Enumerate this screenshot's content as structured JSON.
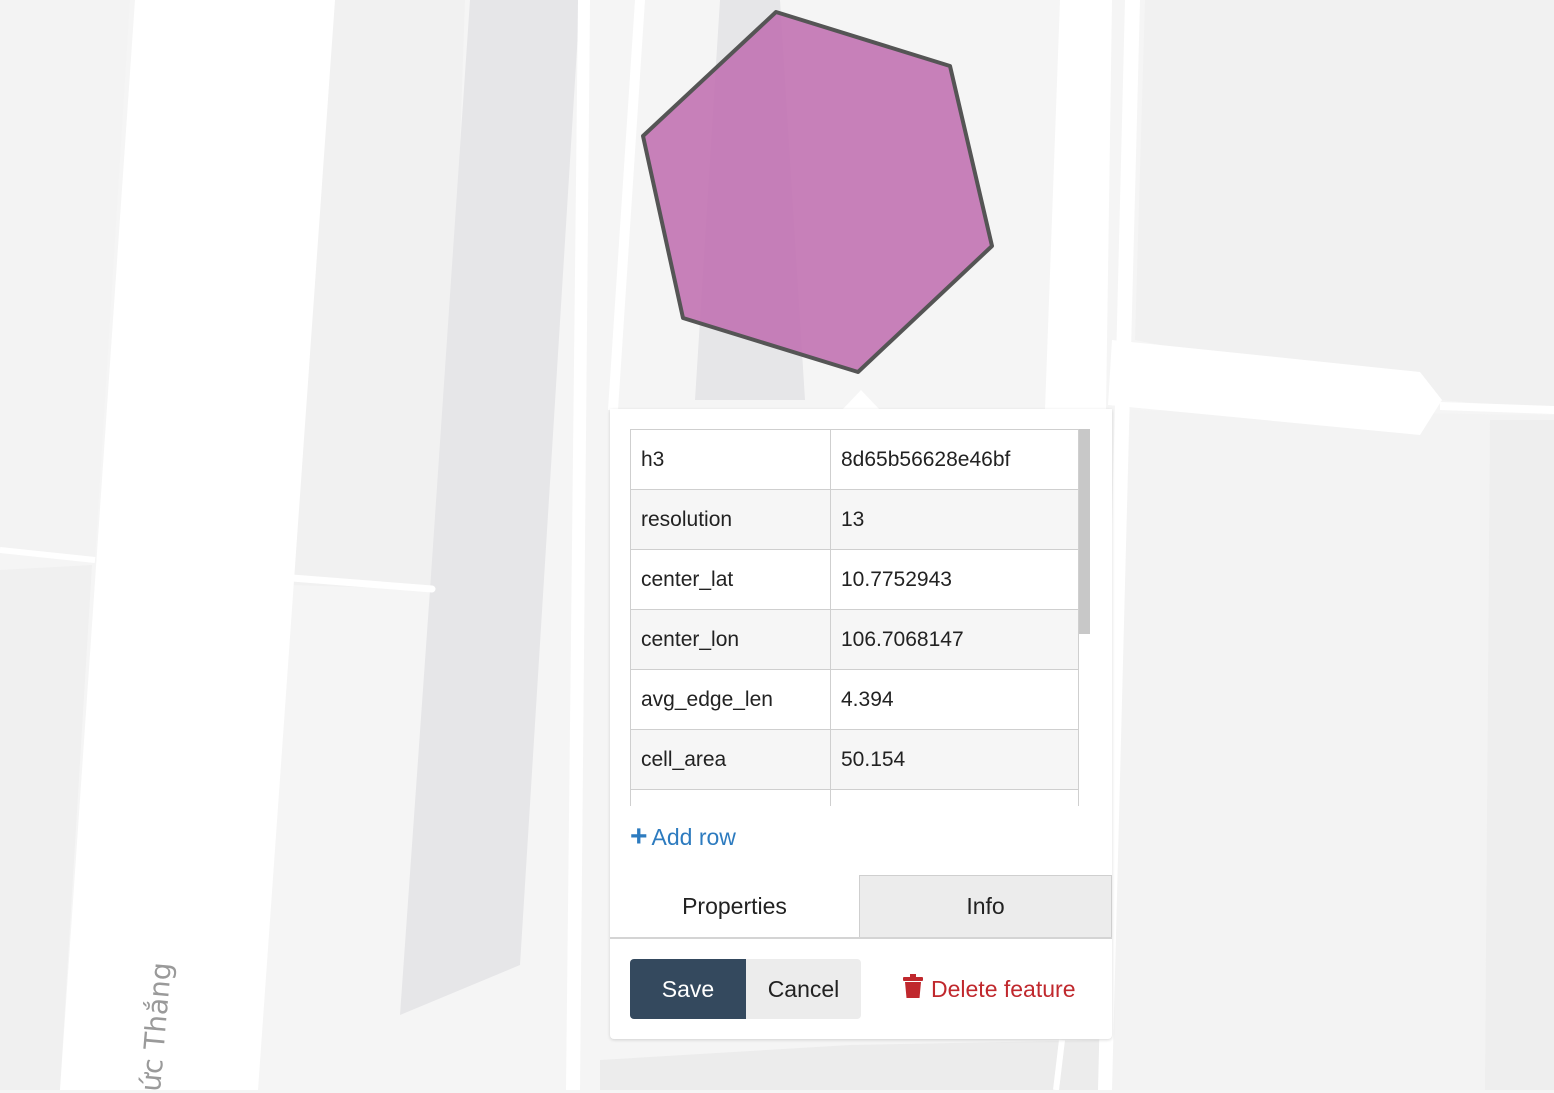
{
  "map": {
    "street_label": "ức Thắng",
    "hexagon_fill": "#c070b0",
    "hexagon_stroke": "#555555"
  },
  "popup": {
    "rows": [
      {
        "key": "h3",
        "value": "8d65b56628e46bf"
      },
      {
        "key": "resolution",
        "value": "13"
      },
      {
        "key": "center_lat",
        "value": "10.7752943"
      },
      {
        "key": "center_lon",
        "value": "106.7068147"
      },
      {
        "key": "avg_edge_len",
        "value": "4.394"
      },
      {
        "key": "cell_area",
        "value": "50.154"
      }
    ],
    "add_row_label": "Add row",
    "tabs": {
      "properties": "Properties",
      "info": "Info"
    },
    "save_label": "Save",
    "cancel_label": "Cancel",
    "delete_label": "Delete feature"
  },
  "colors": {
    "save_bg": "#34495e",
    "link": "#2d7bbf",
    "delete": "#c0282d"
  }
}
